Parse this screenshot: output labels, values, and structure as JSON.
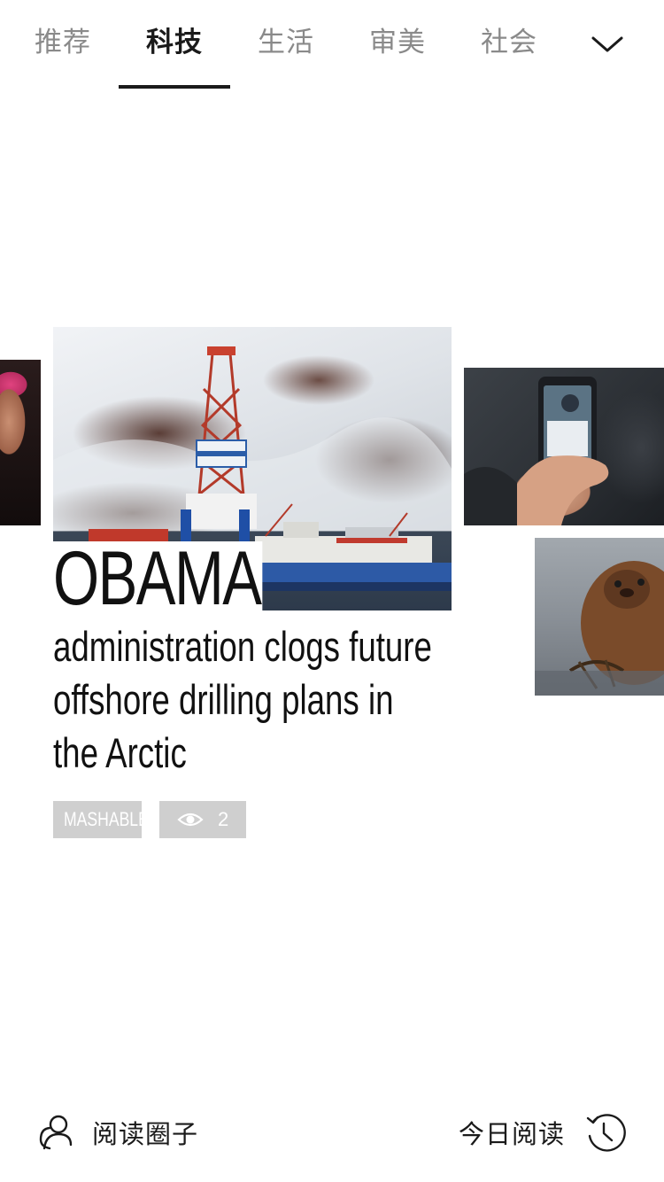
{
  "tabs": [
    {
      "label": "推荐",
      "active": false
    },
    {
      "label": "科技",
      "active": true
    },
    {
      "label": "生活",
      "active": false
    },
    {
      "label": "审美",
      "active": false
    },
    {
      "label": "社会",
      "active": false
    }
  ],
  "tab_expand_icon": "chevron-down-icon",
  "article": {
    "headline_lead": "OBAMA",
    "headline_rest": "administration clogs future offshore drilling plans in the Arctic",
    "source": "MASHABLE",
    "views": "2",
    "views_icon": "eye-icon"
  },
  "bottom_bar": {
    "left": {
      "label": "阅读圈子",
      "icon": "people-icon"
    },
    "right": {
      "label": "今日阅读",
      "icon": "history-clock-icon"
    }
  },
  "colors": {
    "text_primary": "#1a1a1a",
    "text_muted": "#8a8a8a",
    "chip_bg": "#cfcfcf",
    "chip_text": "#ffffff",
    "indicator": "#1a1a1a"
  }
}
